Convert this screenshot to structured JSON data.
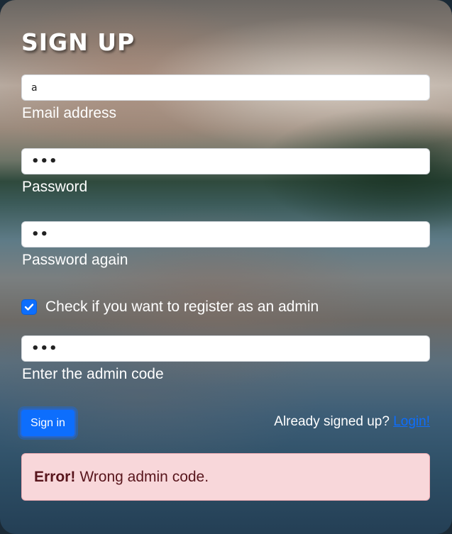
{
  "form": {
    "title": "SIGN UP",
    "email": {
      "value": "a",
      "label": "Email address"
    },
    "password": {
      "masked_value": "•••",
      "label": "Password"
    },
    "password_again": {
      "masked_value": "••",
      "label": "Password again"
    },
    "admin_checkbox": {
      "checked": true,
      "label": "Check if you want to register as an admin"
    },
    "admin_code": {
      "masked_value": "•••",
      "label": "Enter the admin code"
    },
    "submit_label": "Sign in",
    "already_text": "Already signed up?",
    "login_link": "Login!"
  },
  "alert": {
    "strong": "Error!",
    "message": "Wrong admin code."
  },
  "colors": {
    "primary": "#0d6efd",
    "alert_bg": "#f8d7da",
    "alert_text": "#58151c"
  },
  "icons": {
    "checkbox": "check-icon"
  }
}
